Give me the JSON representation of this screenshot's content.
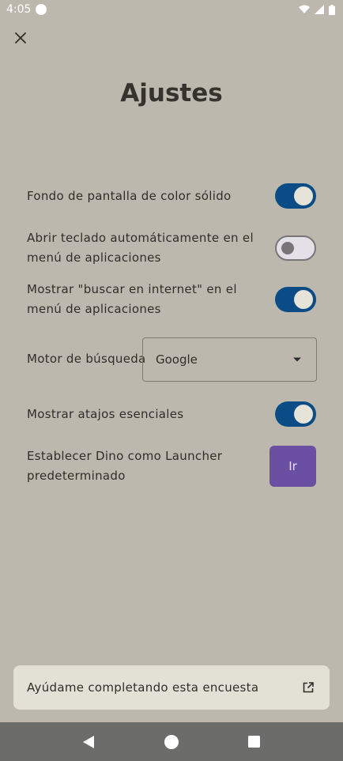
{
  "status_bar": {
    "time": "4:05",
    "icons": [
      "notification-dot-icon",
      "wifi-icon",
      "signal-icon",
      "battery-icon"
    ]
  },
  "header": {
    "close_icon": "close-icon",
    "title": "Ajustes"
  },
  "settings": {
    "solid_wallpaper": {
      "label": "Fondo de pantalla de color sólido",
      "enabled": true
    },
    "auto_keyboard": {
      "label": "Abrir teclado automáticamente en el menú de aplicaciones",
      "enabled": false
    },
    "search_internet": {
      "label": "Mostrar \"buscar en internet\" en el menú de aplicaciones",
      "enabled": true
    },
    "search_engine": {
      "label": "Motor de búsqueda",
      "value": "Google"
    },
    "essential_shortcuts": {
      "label": "Mostrar atajos esenciales",
      "enabled": true
    },
    "default_launcher": {
      "label": "Establecer Dino como Launcher predeterminado",
      "button_label": "Ir"
    }
  },
  "survey": {
    "label": "Ayúdame completando esta encuesta",
    "icon": "open-in-new-icon"
  },
  "nav_bar": {
    "icons": [
      "back-icon",
      "home-icon",
      "recents-icon"
    ]
  },
  "colors": {
    "background": "#BCB8AD",
    "switch_on": "#0C4C86",
    "switch_off_track": "#E4E0E7",
    "accent_button": "#6A4FA3",
    "card": "#E3E0D5",
    "nav_bar": "#6C6C6B"
  }
}
